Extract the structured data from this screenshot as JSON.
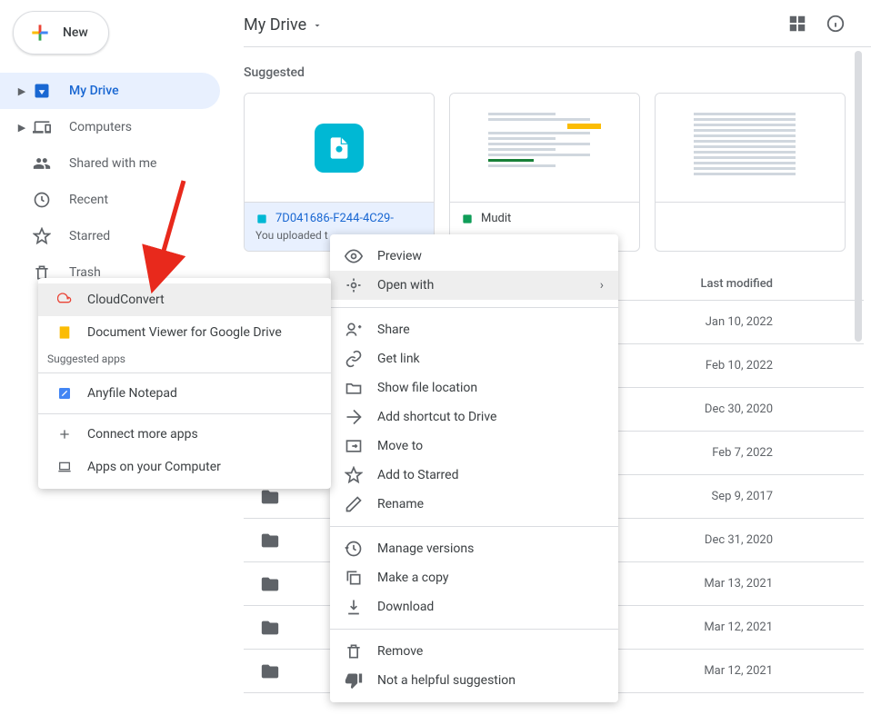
{
  "header": {
    "title": "My Drive"
  },
  "new_button": {
    "label": "New"
  },
  "sidebar": {
    "items": [
      {
        "label": "My Drive"
      },
      {
        "label": "Computers"
      },
      {
        "label": "Shared with me"
      },
      {
        "label": "Recent"
      },
      {
        "label": "Starred"
      },
      {
        "label": "Trash"
      }
    ]
  },
  "suggested": {
    "label": "Suggested",
    "cards": [
      {
        "filename": "7D041686-F244-4C29-",
        "subtitle": "You uploaded t"
      },
      {
        "filename": "Mudit"
      },
      {
        "filename": ""
      }
    ]
  },
  "list": {
    "header": "Last modified",
    "rows": [
      {
        "date": "Jan 10, 2022"
      },
      {
        "date": "Feb 10, 2022"
      },
      {
        "date": "Dec 30, 2020"
      },
      {
        "date": "Feb 7, 2022"
      },
      {
        "date": "Sep 9, 2017"
      },
      {
        "date": "Dec 31, 2020"
      },
      {
        "date": "Mar 13, 2021"
      },
      {
        "date": "Mar 12, 2021"
      },
      {
        "date": "Mar 12, 2021"
      }
    ]
  },
  "context_menu": {
    "items": [
      {
        "label": "Preview"
      },
      {
        "label": "Open with"
      },
      {
        "label": "Share"
      },
      {
        "label": "Get link"
      },
      {
        "label": "Show file location"
      },
      {
        "label": "Add shortcut to Drive"
      },
      {
        "label": "Move to"
      },
      {
        "label": "Add to Starred"
      },
      {
        "label": "Rename"
      },
      {
        "label": "Manage versions"
      },
      {
        "label": "Make a copy"
      },
      {
        "label": "Download"
      },
      {
        "label": "Remove"
      },
      {
        "label": "Not a helpful suggestion"
      }
    ]
  },
  "open_with_submenu": {
    "items": [
      {
        "label": "CloudConvert"
      },
      {
        "label": "Document Viewer for Google Drive"
      }
    ],
    "suggested_heading": "Suggested apps",
    "suggested_items": [
      {
        "label": "Anyfile Notepad"
      }
    ],
    "footer_items": [
      {
        "label": "Connect more apps"
      },
      {
        "label": "Apps on your Computer"
      }
    ]
  }
}
